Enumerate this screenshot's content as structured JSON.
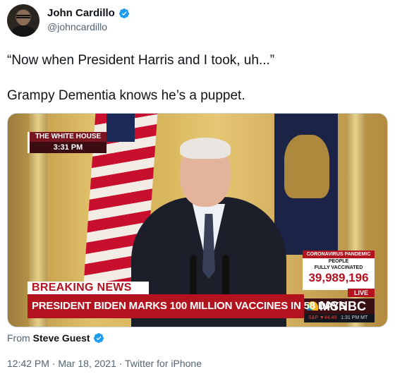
{
  "author": {
    "display_name": "John Cardillo",
    "handle": "@johncardillo",
    "verified_icon": "verified-badge-icon"
  },
  "tweet": {
    "line1": "“Now when President Harris and I took, uh...”",
    "line2": "Grampy Dementia knows he’s a puppet."
  },
  "media": {
    "bug_line1": "THE WHITE HOUSE",
    "bug_line2": "3:31 PM",
    "vax_header": "CORONAVIRUS PANDEMIC",
    "vax_line1": "PEOPLE",
    "vax_line2": "FULLY VACCINATED",
    "vax_number": "39,989,196",
    "live": "LIVE",
    "network": "MSNBC",
    "ticker_left": "S&P ▼44.49",
    "ticker_right": "1:31 PM MT",
    "breaking": "BREAKING NEWS",
    "chyron": "PRESIDENT BIDEN MARKS 100 MILLION VACCINES IN 58 DAYS"
  },
  "attribution": {
    "prefix": "From",
    "source": "Steve Guest"
  },
  "meta": {
    "text": "12:42 PM · Mar 18, 2021 · Twitter for iPhone"
  },
  "colors": {
    "verified_blue": "#1d9bf0",
    "msnbc_red": "#b3121f"
  }
}
